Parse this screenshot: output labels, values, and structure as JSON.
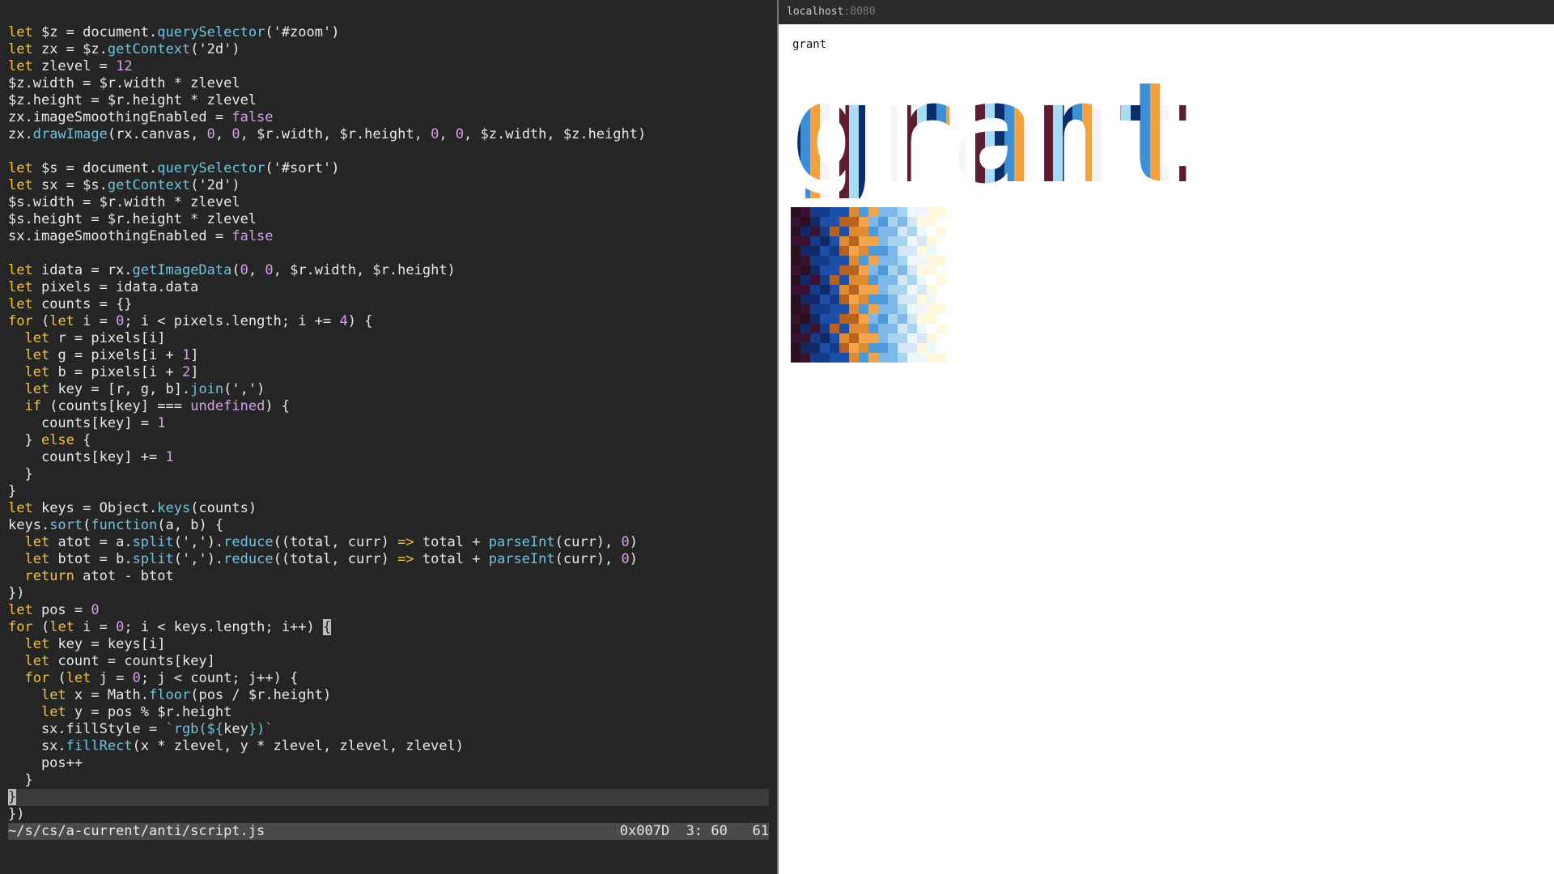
{
  "editor": {
    "lines": [
      [
        [
          "kw",
          "let"
        ],
        [
          "t",
          " $z = document."
        ],
        [
          "fn",
          "querySelector"
        ],
        [
          "t",
          "('#zoom')"
        ]
      ],
      [
        [
          "kw",
          "let"
        ],
        [
          "t",
          " zx = $z."
        ],
        [
          "fn",
          "getContext"
        ],
        [
          "t",
          "('2d')"
        ]
      ],
      [
        [
          "kw",
          "let"
        ],
        [
          "t",
          " zlevel = "
        ],
        [
          "num",
          "12"
        ]
      ],
      [
        [
          "t",
          "$z.width = $r.width * zlevel"
        ]
      ],
      [
        [
          "t",
          "$z.height = $r.height * zlevel"
        ]
      ],
      [
        [
          "t",
          "zx.imageSmoothingEnabled = "
        ],
        [
          "bool",
          "false"
        ]
      ],
      [
        [
          "t",
          "zx."
        ],
        [
          "fn",
          "drawImage"
        ],
        [
          "t",
          "(rx.canvas, "
        ],
        [
          "num",
          "0"
        ],
        [
          "t",
          ", "
        ],
        [
          "num",
          "0"
        ],
        [
          "t",
          ", $r.width, $r.height, "
        ],
        [
          "num",
          "0"
        ],
        [
          "t",
          ", "
        ],
        [
          "num",
          "0"
        ],
        [
          "t",
          ", $z.width, $z.height)"
        ]
      ],
      [],
      [
        [
          "kw",
          "let"
        ],
        [
          "t",
          " $s = document."
        ],
        [
          "fn",
          "querySelector"
        ],
        [
          "t",
          "('#sort')"
        ]
      ],
      [
        [
          "kw",
          "let"
        ],
        [
          "t",
          " sx = $s."
        ],
        [
          "fn",
          "getContext"
        ],
        [
          "t",
          "('2d')"
        ]
      ],
      [
        [
          "t",
          "$s.width = $r.width * zlevel"
        ]
      ],
      [
        [
          "t",
          "$s.height = $r.height * zlevel"
        ]
      ],
      [
        [
          "t",
          "sx.imageSmoothingEnabled = "
        ],
        [
          "bool",
          "false"
        ]
      ],
      [],
      [
        [
          "kw",
          "let"
        ],
        [
          "t",
          " idata = rx."
        ],
        [
          "fn",
          "getImageData"
        ],
        [
          "t",
          "("
        ],
        [
          "num",
          "0"
        ],
        [
          "t",
          ", "
        ],
        [
          "num",
          "0"
        ],
        [
          "t",
          ", $r.width, $r.height)"
        ]
      ],
      [
        [
          "kw",
          "let"
        ],
        [
          "t",
          " pixels = idata.data"
        ]
      ],
      [
        [
          "kw",
          "let"
        ],
        [
          "t",
          " counts = {}"
        ]
      ],
      [
        [
          "kw",
          "for"
        ],
        [
          "t",
          " ("
        ],
        [
          "kw",
          "let"
        ],
        [
          "t",
          " i = "
        ],
        [
          "num",
          "0"
        ],
        [
          "t",
          "; i < pixels.length; i += "
        ],
        [
          "num",
          "4"
        ],
        [
          "t",
          ") {"
        ]
      ],
      [
        [
          "t",
          "  "
        ],
        [
          "kw",
          "let"
        ],
        [
          "t",
          " r = pixels[i]"
        ]
      ],
      [
        [
          "t",
          "  "
        ],
        [
          "kw",
          "let"
        ],
        [
          "t",
          " g = pixels[i + "
        ],
        [
          "num",
          "1"
        ],
        [
          "t",
          "]"
        ]
      ],
      [
        [
          "t",
          "  "
        ],
        [
          "kw",
          "let"
        ],
        [
          "t",
          " b = pixels[i + "
        ],
        [
          "num",
          "2"
        ],
        [
          "t",
          "]"
        ]
      ],
      [
        [
          "t",
          "  "
        ],
        [
          "kw",
          "let"
        ],
        [
          "t",
          " key = [r, g, b]."
        ],
        [
          "fn",
          "join"
        ],
        [
          "t",
          "(',')"
        ]
      ],
      [
        [
          "t",
          "  "
        ],
        [
          "kw",
          "if"
        ],
        [
          "t",
          " (counts[key] === "
        ],
        [
          "und",
          "undefined"
        ],
        [
          "t",
          ") {"
        ]
      ],
      [
        [
          "t",
          "    counts[key] = "
        ],
        [
          "num",
          "1"
        ]
      ],
      [
        [
          "t",
          "  } "
        ],
        [
          "kw",
          "else"
        ],
        [
          "t",
          " {"
        ]
      ],
      [
        [
          "t",
          "    counts[key] += "
        ],
        [
          "num",
          "1"
        ]
      ],
      [
        [
          "t",
          "  }"
        ]
      ],
      [
        [
          "t",
          "}"
        ]
      ],
      [
        [
          "kw",
          "let"
        ],
        [
          "t",
          " keys = Object."
        ],
        [
          "fn",
          "keys"
        ],
        [
          "t",
          "(counts)"
        ]
      ],
      [
        [
          "t",
          "keys."
        ],
        [
          "fn",
          "sort"
        ],
        [
          "t",
          "("
        ],
        [
          "fn",
          "function"
        ],
        [
          "t",
          "(a, b) {"
        ]
      ],
      [
        [
          "t",
          "  "
        ],
        [
          "kw",
          "let"
        ],
        [
          "t",
          " atot = a."
        ],
        [
          "fn",
          "split"
        ],
        [
          "t",
          "(',')."
        ],
        [
          "fn",
          "reduce"
        ],
        [
          "t",
          "((total, curr) "
        ],
        [
          "arrow",
          "=>"
        ],
        [
          "t",
          " total + "
        ],
        [
          "fn",
          "parseInt"
        ],
        [
          "t",
          "(curr), "
        ],
        [
          "num",
          "0"
        ],
        [
          "t",
          ")"
        ]
      ],
      [
        [
          "t",
          "  "
        ],
        [
          "kw",
          "let"
        ],
        [
          "t",
          " btot = b."
        ],
        [
          "fn",
          "split"
        ],
        [
          "t",
          "(',')."
        ],
        [
          "fn",
          "reduce"
        ],
        [
          "t",
          "((total, curr) "
        ],
        [
          "arrow",
          "=>"
        ],
        [
          "t",
          " total + "
        ],
        [
          "fn",
          "parseInt"
        ],
        [
          "t",
          "(curr), "
        ],
        [
          "num",
          "0"
        ],
        [
          "t",
          ")"
        ]
      ],
      [
        [
          "t",
          "  "
        ],
        [
          "kw",
          "return"
        ],
        [
          "t",
          " atot - btot"
        ]
      ],
      [
        [
          "t",
          "})"
        ]
      ],
      [
        [
          "kw",
          "let"
        ],
        [
          "t",
          " pos = "
        ],
        [
          "num",
          "0"
        ]
      ],
      [
        [
          "kw",
          "for"
        ],
        [
          "t",
          " ("
        ],
        [
          "kw",
          "let"
        ],
        [
          "t",
          " i = "
        ],
        [
          "num",
          "0"
        ],
        [
          "t",
          "; i < keys.length; i++) "
        ],
        [
          "cur",
          "{"
        ]
      ],
      [
        [
          "t",
          "  "
        ],
        [
          "kw",
          "let"
        ],
        [
          "t",
          " key = keys[i]"
        ]
      ],
      [
        [
          "t",
          "  "
        ],
        [
          "kw",
          "let"
        ],
        [
          "t",
          " count = counts[key]"
        ]
      ],
      [
        [
          "t",
          "  "
        ],
        [
          "kw",
          "for"
        ],
        [
          "t",
          " ("
        ],
        [
          "kw",
          "let"
        ],
        [
          "t",
          " j = "
        ],
        [
          "num",
          "0"
        ],
        [
          "t",
          "; j < count; j++) {"
        ]
      ],
      [
        [
          "t",
          "    "
        ],
        [
          "kw",
          "let"
        ],
        [
          "t",
          " x = Math."
        ],
        [
          "fn",
          "floor"
        ],
        [
          "t",
          "(pos / $r.height)"
        ]
      ],
      [
        [
          "t",
          "    "
        ],
        [
          "kw",
          "let"
        ],
        [
          "t",
          " y = pos % $r.height"
        ]
      ],
      [
        [
          "t",
          "    sx.fillStyle = "
        ],
        [
          "fn",
          "`rgb(${"
        ],
        [
          "t",
          "key"
        ],
        [
          "fn",
          "})`"
        ]
      ],
      [
        [
          "t",
          "    sx."
        ],
        [
          "fn",
          "fillRect"
        ],
        [
          "t",
          "(x * zlevel, y * zlevel, zlevel, zlevel)"
        ]
      ],
      [
        [
          "t",
          "    pos++"
        ]
      ],
      [
        [
          "t",
          "  }"
        ]
      ],
      [
        [
          "cur",
          "}"
        ]
      ],
      [
        [
          "t",
          "})"
        ]
      ]
    ],
    "current_line": 45,
    "status_path": "~/s/cs/a-current/anti/script.js",
    "status_pos": "0x007D  3: 60   61"
  },
  "browser": {
    "host": "localhost",
    "port": ":8080",
    "page_text": "grant",
    "zoom_text": "grant"
  }
}
